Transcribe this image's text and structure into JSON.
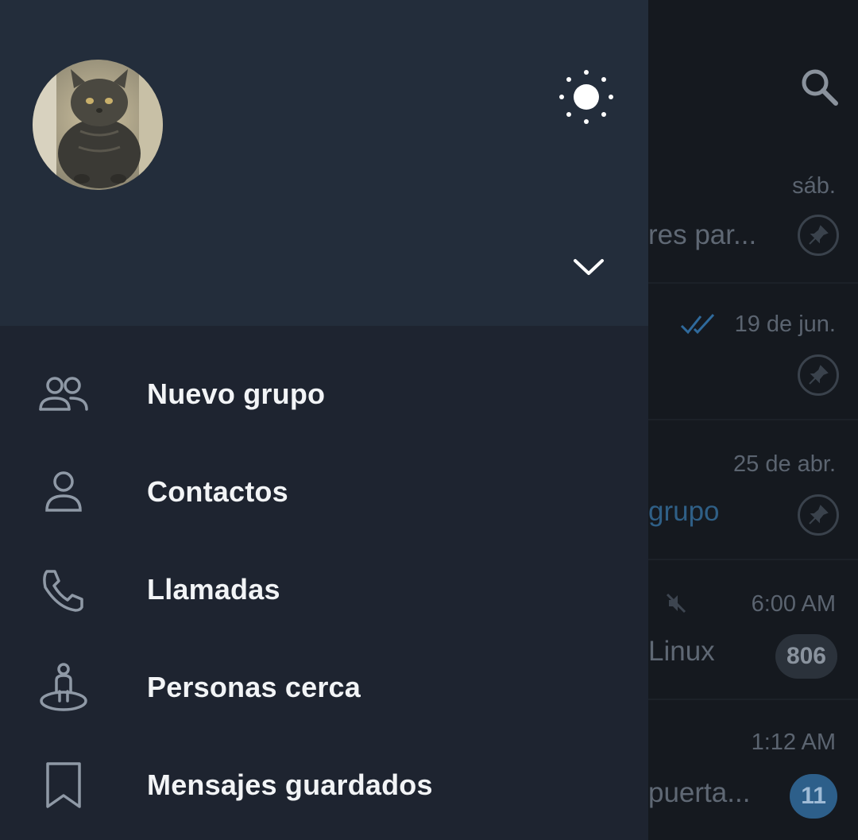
{
  "colors": {
    "drawer_header_bg": "#232d3b",
    "drawer_bg": "#1e2430",
    "menu_text": "#f2f4f6",
    "icon_color": "#8f99a6",
    "accent_blue": "#2d5f8a"
  },
  "header": {
    "theme_icon": "sun-icon",
    "expand_icon": "chevron-down-icon",
    "avatar": "profile-avatar-cat"
  },
  "menu": [
    {
      "label": "Nuevo grupo",
      "icon": "new-group-icon"
    },
    {
      "label": "Contactos",
      "icon": "contacts-icon"
    },
    {
      "label": "Llamadas",
      "icon": "phone-icon"
    },
    {
      "label": "Personas cerca",
      "icon": "people-nearby-icon"
    },
    {
      "label": "Mensajes guardados",
      "icon": "bookmark-icon"
    }
  ],
  "background_chats": [
    {
      "time": "sáb.",
      "preview": "res par...",
      "badge": "pin-icon"
    },
    {
      "time": "19 de jun.",
      "preview": "",
      "badge": "pin-icon",
      "read_ticks": "double-check-icon"
    },
    {
      "time": "25 de abr.",
      "preview": "grupo",
      "badge": "pin-icon"
    },
    {
      "time": "6:00 AM",
      "preview": "Linux",
      "unread": "806",
      "muted": "muted-icon"
    },
    {
      "time": "1:12 AM",
      "preview": "puerta...",
      "unread": "11"
    }
  ]
}
